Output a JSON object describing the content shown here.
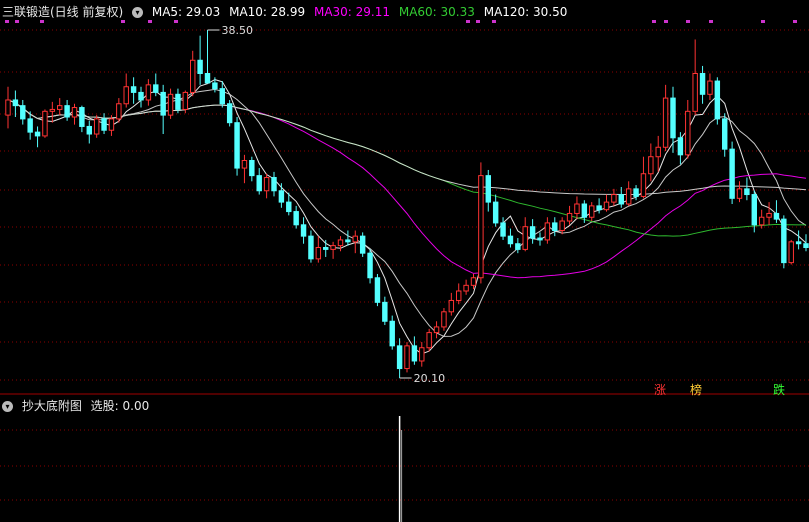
{
  "header": {
    "title": "三联锻造(日线 前复权)",
    "toggle_icon": "chevron-down-icon",
    "ma": [
      {
        "label": "MA5: 29.03",
        "color": "#ffffff"
      },
      {
        "label": "MA10: 28.99",
        "color": "#ffffff"
      },
      {
        "label": "MA30: 29.11",
        "color": "#ff00ff"
      },
      {
        "label": "MA60: 30.33",
        "color": "#33cc33"
      },
      {
        "label": "MA120: 30.50",
        "color": "#ffffff"
      }
    ]
  },
  "sub_header": {
    "title": "抄大底附图",
    "value_label": "选股: 0.00"
  },
  "annotations": {
    "high": "38.50",
    "low": "20.10"
  },
  "markers": [
    {
      "label": "涨",
      "color": "#ff3333"
    },
    {
      "label": "榜",
      "color": "#ffcc33"
    },
    {
      "label": "跌",
      "color": "#33ff33"
    }
  ],
  "colors": {
    "up": "#ff3333",
    "down": "#54ffff",
    "grid": "#8b0000",
    "bg": "#000000",
    "dots": "#cc33cc"
  },
  "chart_data": {
    "type": "candlestick",
    "y_range": [
      20.1,
      38.5
    ],
    "note_high": 38.5,
    "note_low": 20.1,
    "ohlc": [
      [
        34.0,
        35.5,
        33.3,
        34.8
      ],
      [
        34.8,
        35.3,
        33.9,
        34.5
      ],
      [
        34.5,
        34.8,
        33.5,
        33.8
      ],
      [
        33.8,
        34.2,
        32.7,
        33.1
      ],
      [
        33.1,
        33.4,
        32.3,
        32.9
      ],
      [
        32.9,
        34.3,
        32.8,
        34.2
      ],
      [
        34.2,
        34.7,
        33.6,
        34.3
      ],
      [
        34.3,
        34.9,
        34.0,
        34.5
      ],
      [
        34.5,
        34.8,
        33.7,
        33.9
      ],
      [
        33.9,
        34.6,
        33.5,
        34.4
      ],
      [
        34.4,
        34.5,
        33.1,
        33.4
      ],
      [
        33.4,
        33.7,
        32.5,
        33.0
      ],
      [
        33.0,
        34.0,
        32.8,
        33.8
      ],
      [
        33.8,
        34.1,
        33.0,
        33.2
      ],
      [
        33.2,
        34.0,
        32.9,
        33.8
      ],
      [
        33.8,
        34.9,
        33.6,
        34.6
      ],
      [
        34.6,
        36.2,
        34.4,
        35.5
      ],
      [
        35.5,
        36.0,
        34.6,
        35.2
      ],
      [
        35.2,
        35.5,
        34.4,
        34.8
      ],
      [
        34.8,
        35.9,
        34.5,
        35.6
      ],
      [
        35.6,
        36.2,
        35.0,
        35.2
      ],
      [
        35.2,
        35.6,
        33.0,
        34.0
      ],
      [
        34.0,
        35.4,
        33.8,
        35.1
      ],
      [
        35.1,
        35.4,
        34.1,
        34.3
      ],
      [
        34.3,
        35.3,
        34.1,
        35.2
      ],
      [
        35.2,
        37.4,
        35.0,
        36.9
      ],
      [
        36.9,
        38.2,
        35.6,
        36.2
      ],
      [
        36.2,
        38.5,
        35.8,
        35.7
      ],
      [
        35.7,
        36.0,
        35.2,
        35.4
      ],
      [
        35.4,
        35.8,
        34.4,
        34.6
      ],
      [
        34.6,
        34.8,
        33.4,
        33.6
      ],
      [
        33.6,
        33.9,
        30.8,
        31.2
      ],
      [
        31.2,
        31.9,
        30.4,
        31.6
      ],
      [
        31.6,
        31.8,
        30.5,
        30.8
      ],
      [
        30.8,
        31.2,
        29.8,
        30.0
      ],
      [
        30.0,
        30.9,
        29.6,
        30.7
      ],
      [
        30.7,
        31.0,
        29.7,
        30.0
      ],
      [
        30.0,
        30.4,
        29.1,
        29.4
      ],
      [
        29.4,
        29.9,
        28.7,
        28.9
      ],
      [
        28.9,
        29.2,
        28.0,
        28.2
      ],
      [
        28.2,
        28.6,
        27.2,
        27.6
      ],
      [
        27.6,
        27.9,
        26.2,
        26.4
      ],
      [
        26.4,
        27.6,
        26.2,
        27.0
      ],
      [
        27.0,
        27.4,
        26.5,
        26.9
      ],
      [
        26.9,
        27.3,
        26.4,
        27.1
      ],
      [
        27.1,
        27.6,
        26.8,
        27.4
      ],
      [
        27.4,
        27.9,
        27.1,
        27.3
      ],
      [
        27.3,
        27.9,
        26.7,
        27.6
      ],
      [
        27.6,
        27.8,
        26.5,
        26.7
      ],
      [
        26.7,
        26.9,
        25.1,
        25.4
      ],
      [
        25.4,
        25.6,
        23.9,
        24.1
      ],
      [
        24.1,
        24.4,
        22.9,
        23.1
      ],
      [
        23.1,
        23.4,
        21.6,
        21.8
      ],
      [
        21.8,
        22.2,
        20.1,
        20.6
      ],
      [
        20.6,
        22.0,
        20.4,
        21.8
      ],
      [
        21.8,
        22.3,
        20.8,
        21.0
      ],
      [
        21.0,
        22.0,
        20.7,
        21.7
      ],
      [
        21.7,
        22.7,
        21.5,
        22.5
      ],
      [
        22.5,
        23.1,
        22.2,
        22.8
      ],
      [
        22.8,
        23.8,
        22.6,
        23.6
      ],
      [
        23.6,
        24.6,
        23.4,
        24.2
      ],
      [
        24.2,
        25.1,
        24.0,
        24.7
      ],
      [
        24.7,
        25.3,
        24.5,
        25.0
      ],
      [
        25.0,
        25.6,
        24.8,
        25.4
      ],
      [
        25.4,
        31.5,
        25.1,
        30.8
      ],
      [
        30.8,
        31.1,
        28.9,
        29.4
      ],
      [
        29.4,
        29.8,
        28.1,
        28.3
      ],
      [
        28.3,
        28.6,
        27.4,
        27.6
      ],
      [
        27.6,
        28.0,
        27.0,
        27.2
      ],
      [
        27.2,
        27.5,
        26.7,
        26.9
      ],
      [
        26.9,
        28.6,
        26.8,
        28.1
      ],
      [
        28.1,
        28.5,
        27.2,
        27.5
      ],
      [
        27.5,
        27.8,
        27.1,
        27.4
      ],
      [
        27.4,
        28.6,
        27.2,
        28.3
      ],
      [
        28.3,
        28.6,
        27.6,
        27.9
      ],
      [
        27.9,
        28.6,
        27.7,
        28.4
      ],
      [
        28.4,
        29.2,
        28.2,
        28.8
      ],
      [
        28.8,
        29.7,
        28.5,
        29.3
      ],
      [
        29.3,
        29.5,
        28.3,
        28.6
      ],
      [
        28.6,
        29.4,
        28.4,
        29.2
      ],
      [
        29.2,
        29.6,
        28.8,
        29.0
      ],
      [
        29.0,
        29.8,
        28.9,
        29.4
      ],
      [
        29.4,
        30.1,
        29.2,
        29.8
      ],
      [
        29.8,
        30.2,
        29.1,
        29.3
      ],
      [
        29.3,
        30.5,
        29.2,
        30.1
      ],
      [
        30.1,
        30.3,
        29.5,
        29.7
      ],
      [
        29.7,
        31.8,
        29.6,
        30.9
      ],
      [
        30.9,
        32.5,
        30.5,
        31.8
      ],
      [
        31.8,
        32.9,
        31.0,
        32.3
      ],
      [
        32.3,
        35.6,
        32.1,
        34.9
      ],
      [
        34.9,
        35.5,
        32.0,
        32.8
      ],
      [
        32.8,
        33.1,
        31.4,
        31.9
      ],
      [
        31.9,
        34.8,
        31.7,
        34.2
      ],
      [
        34.2,
        38.0,
        34.0,
        36.2
      ],
      [
        36.2,
        36.6,
        34.6,
        35.1
      ],
      [
        35.1,
        36.2,
        34.8,
        35.8
      ],
      [
        35.8,
        36.0,
        33.5,
        33.8
      ],
      [
        33.8,
        34.1,
        31.8,
        32.2
      ],
      [
        32.2,
        32.6,
        29.3,
        29.6
      ],
      [
        29.6,
        30.5,
        29.4,
        30.1
      ],
      [
        30.1,
        30.7,
        29.5,
        29.8
      ],
      [
        29.8,
        30.0,
        27.8,
        28.2
      ],
      [
        28.2,
        29.0,
        28.0,
        28.6
      ],
      [
        28.6,
        29.4,
        28.2,
        28.8
      ],
      [
        28.8,
        29.5,
        28.3,
        28.5
      ],
      [
        28.5,
        28.7,
        25.9,
        26.2
      ],
      [
        26.2,
        27.4,
        26.1,
        27.3
      ],
      [
        27.3,
        27.9,
        26.9,
        27.2
      ],
      [
        27.2,
        27.7,
        26.8,
        27.0
      ]
    ],
    "sub_series": [
      {
        "name": "选股",
        "signal_index": 53,
        "signal_value": 1
      }
    ]
  }
}
